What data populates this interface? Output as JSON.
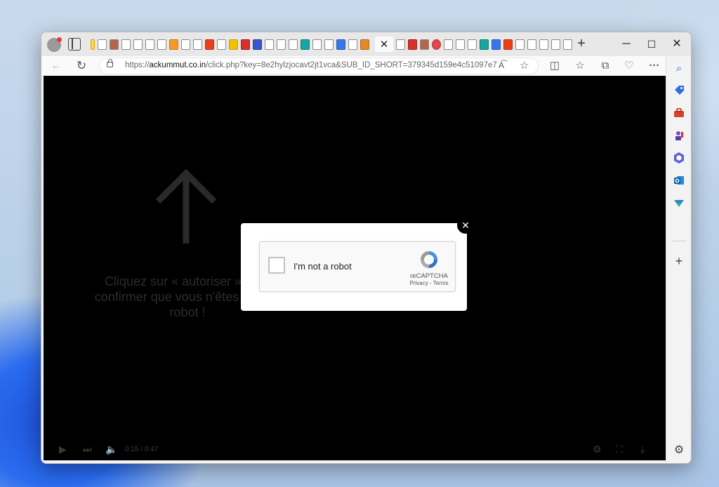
{
  "browser": {
    "active_tab_close": "✕",
    "new_tab": "+",
    "window_controls": {
      "minimize": "─",
      "maximize": "☐",
      "close": "✕"
    }
  },
  "address_bar": {
    "url_prefix": "https://",
    "url_host": "ackummut.co.in",
    "url_path": "/click.php?key=8e2hylzjocavt2jt1vca&SUB_ID_SHORT=379345d159e4c51097e71...",
    "read_aloud": "A͡",
    "favorite": "☆"
  },
  "page": {
    "overlay_text": "Cliquez sur « autoriser » pour confirmer que vous n'êtes pas un robot !",
    "modal_close": "✕",
    "captcha": {
      "label": "I'm not a robot",
      "brand": "reCAPTCHA",
      "links": "Privacy - Terms"
    },
    "player": {
      "time": "0:15 / 0:47"
    }
  },
  "icons": {
    "back": "←",
    "refresh": "↻",
    "split": "◫",
    "favorites": "☆",
    "collections": "⧉",
    "performance": "♡",
    "more": "···"
  },
  "colors": {
    "page_bg": "#000000",
    "accent_blue": "#1a73e8",
    "recaptcha_blue": "#4a90e2"
  }
}
